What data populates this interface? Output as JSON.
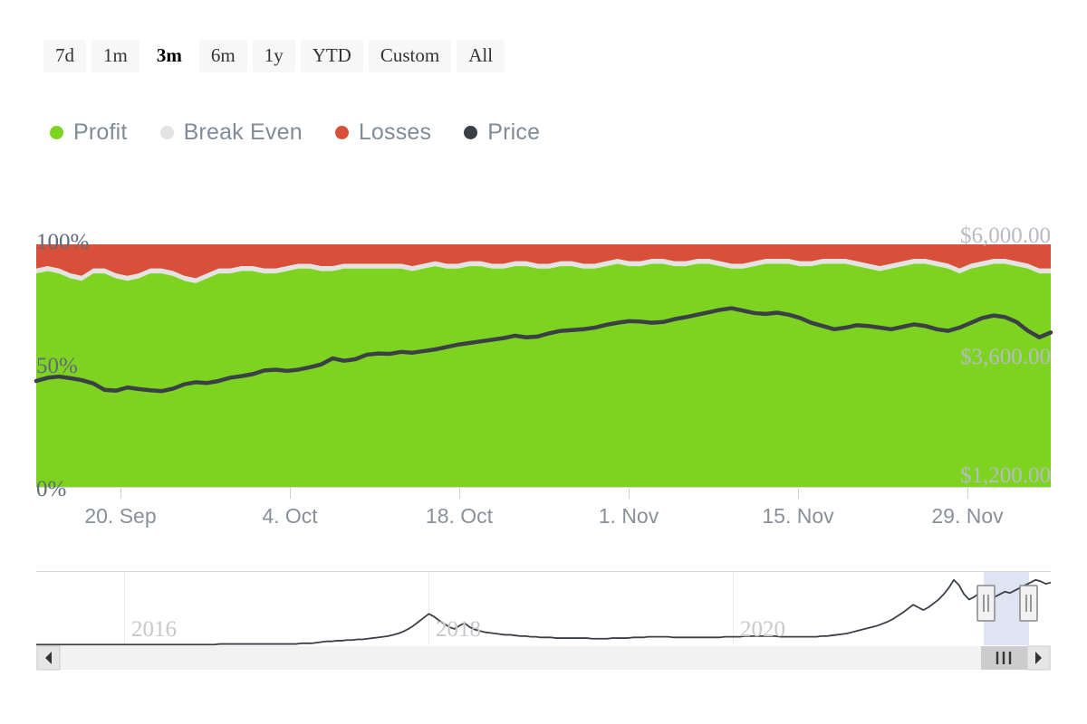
{
  "range_selector": {
    "buttons": [
      {
        "label": "7d",
        "selected": false
      },
      {
        "label": "1m",
        "selected": false
      },
      {
        "label": "3m",
        "selected": true
      },
      {
        "label": "6m",
        "selected": false
      },
      {
        "label": "1y",
        "selected": false
      },
      {
        "label": "YTD",
        "selected": false
      },
      {
        "label": "Custom",
        "selected": false
      },
      {
        "label": "All",
        "selected": false
      }
    ]
  },
  "legend": {
    "items": [
      {
        "label": "Profit",
        "color": "#7ED321"
      },
      {
        "label": "Break Even",
        "color": "#e3e3e3"
      },
      {
        "label": "Losses",
        "color": "#d9503a"
      },
      {
        "label": "Price",
        "color": "#3b4047"
      }
    ]
  },
  "chart_data": {
    "type": "area",
    "title": "",
    "xlabel": "",
    "ylabel": "",
    "grid": false,
    "legend_position": "top",
    "y_left": {
      "label": "",
      "ticks": [
        "0%",
        "50%",
        "100%"
      ],
      "ylim": [
        0,
        100
      ]
    },
    "y_right": {
      "label": "",
      "ticks": [
        "$1,200.00",
        "$3,600.00",
        "$6,000.00"
      ],
      "ylim": [
        0,
        6000
      ]
    },
    "x_ticks": [
      "20. Sep",
      "4. Oct",
      "18. Oct",
      "1. Nov",
      "15. Nov",
      "29. Nov"
    ],
    "stacking": "percent",
    "series": [
      {
        "name": "Profit",
        "color": "#7ED321",
        "values": [
          88,
          89,
          88,
          86,
          85,
          88,
          88,
          86,
          85,
          86,
          88,
          88,
          87,
          85,
          84,
          86,
          88,
          88,
          89,
          89,
          88,
          88,
          89,
          90,
          90,
          89,
          89,
          90,
          90,
          90,
          90,
          90,
          90,
          89,
          90,
          91,
          90,
          90,
          91,
          91,
          90,
          90,
          91,
          91,
          90,
          90,
          91,
          91,
          90,
          90,
          91,
          92,
          91,
          91,
          92,
          92,
          91,
          91,
          92,
          92,
          91,
          90,
          90,
          91,
          92,
          92,
          92,
          91,
          91,
          92,
          92,
          92,
          91,
          90,
          89,
          90,
          91,
          92,
          92,
          91,
          90,
          88,
          90,
          91,
          92,
          92,
          91,
          90,
          88,
          88
        ]
      },
      {
        "name": "Break Even",
        "color": "#e3e3e3",
        "values": [
          2,
          2,
          2,
          2,
          2,
          2,
          2,
          2,
          2,
          2,
          2,
          2,
          2,
          2,
          2,
          2,
          2,
          2,
          2,
          2,
          2,
          2,
          2,
          2,
          2,
          2,
          2,
          2,
          2,
          2,
          2,
          2,
          2,
          2,
          2,
          2,
          2,
          2,
          2,
          2,
          2,
          2,
          2,
          2,
          2,
          2,
          2,
          2,
          2,
          2,
          2,
          2,
          2,
          2,
          2,
          2,
          2,
          2,
          2,
          2,
          2,
          2,
          2,
          2,
          2,
          2,
          2,
          2,
          2,
          2,
          2,
          2,
          2,
          2,
          2,
          2,
          2,
          2,
          2,
          2,
          2,
          2,
          2,
          2,
          2,
          2,
          2,
          2,
          2,
          2
        ]
      },
      {
        "name": "Losses",
        "color": "#d9503a",
        "values": [
          10,
          9,
          10,
          12,
          13,
          10,
          10,
          12,
          13,
          12,
          10,
          10,
          11,
          13,
          14,
          12,
          10,
          10,
          9,
          9,
          10,
          10,
          9,
          8,
          8,
          9,
          9,
          8,
          8,
          8,
          8,
          8,
          8,
          9,
          8,
          7,
          8,
          8,
          7,
          7,
          8,
          8,
          7,
          7,
          8,
          8,
          7,
          7,
          8,
          8,
          7,
          6,
          7,
          7,
          6,
          6,
          7,
          7,
          6,
          6,
          7,
          8,
          8,
          7,
          6,
          6,
          6,
          7,
          7,
          6,
          6,
          6,
          7,
          8,
          9,
          8,
          7,
          6,
          6,
          7,
          8,
          10,
          8,
          7,
          6,
          6,
          7,
          8,
          10,
          10
        ]
      }
    ],
    "price_series": {
      "name": "Price",
      "color": "#3b4047",
      "axis": "right",
      "values": [
        2620,
        2700,
        2730,
        2690,
        2640,
        2560,
        2400,
        2380,
        2460,
        2420,
        2390,
        2370,
        2430,
        2540,
        2590,
        2570,
        2620,
        2700,
        2740,
        2790,
        2880,
        2900,
        2870,
        2900,
        2960,
        3030,
        3180,
        3120,
        3160,
        3270,
        3300,
        3290,
        3340,
        3320,
        3360,
        3400,
        3460,
        3520,
        3560,
        3600,
        3640,
        3680,
        3740,
        3700,
        3720,
        3800,
        3860,
        3880,
        3900,
        3940,
        4010,
        4060,
        4100,
        4090,
        4060,
        4080,
        4150,
        4200,
        4260,
        4320,
        4380,
        4420,
        4360,
        4300,
        4280,
        4310,
        4260,
        4180,
        4060,
        3980,
        3900,
        3940,
        4000,
        3980,
        3940,
        3900,
        3960,
        4020,
        3980,
        3900,
        3860,
        3940,
        4060,
        4180,
        4240,
        4200,
        4080,
        3860,
        3700,
        3820
      ]
    }
  },
  "navigator": {
    "year_labels": [
      "2016",
      "2018",
      "2020"
    ],
    "series_color": "#3b4047",
    "selection_color": "#ccd6eb",
    "handles": [
      "left-handle",
      "right-handle"
    ],
    "scrollbar": {
      "left_arrow": "◀",
      "right_arrow": "▶",
      "thumb_grip": "|||"
    }
  }
}
